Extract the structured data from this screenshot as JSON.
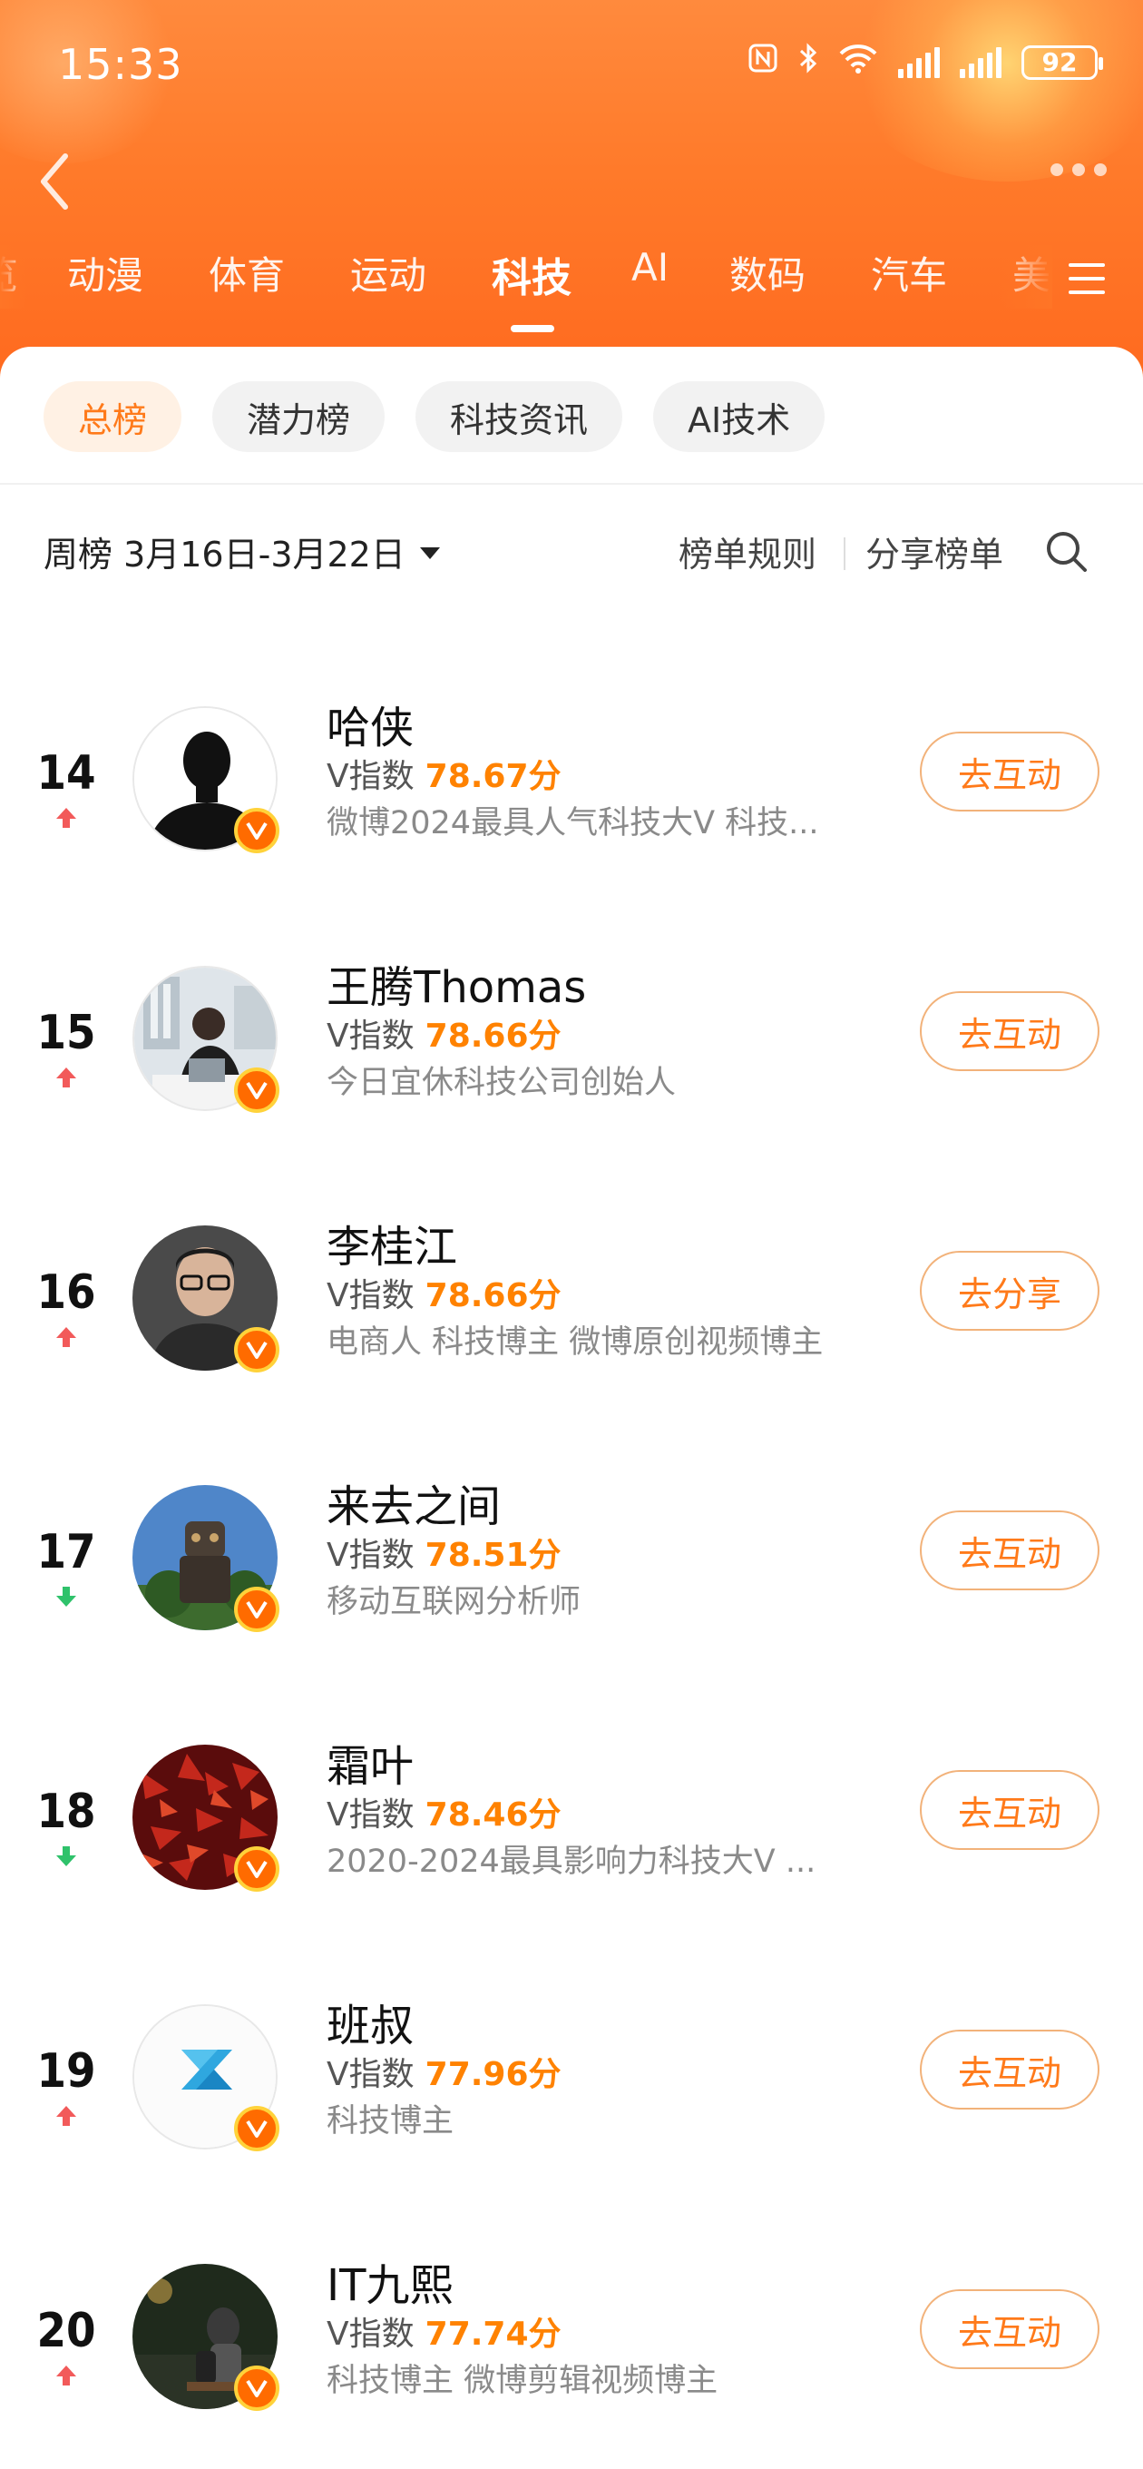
{
  "status_bar": {
    "time": "15:33",
    "battery": "92",
    "icons": [
      "nfc-icon",
      "bluetooth-icon",
      "wifi-icon",
      "signal-icon",
      "signal-icon",
      "battery-icon"
    ]
  },
  "category_tabs": [
    {
      "label": "览",
      "active": false
    },
    {
      "label": "动漫",
      "active": false
    },
    {
      "label": "体育",
      "active": false
    },
    {
      "label": "运动",
      "active": false
    },
    {
      "label": "科技",
      "active": true
    },
    {
      "label": "AI",
      "active": false
    },
    {
      "label": "数码",
      "active": false
    },
    {
      "label": "汽车",
      "active": false
    },
    {
      "label": "美",
      "active": false
    }
  ],
  "sub_tabs": [
    {
      "label": "总榜",
      "active": true
    },
    {
      "label": "潜力榜",
      "active": false
    },
    {
      "label": "科技资讯",
      "active": false
    },
    {
      "label": "AI技术",
      "active": false
    }
  ],
  "filter": {
    "week_label": "周榜 3月16日-3月22日",
    "rules_label": "榜单规则",
    "share_label": "分享榜单"
  },
  "v_index_label": "V指数",
  "rankings": [
    {
      "rank": "14",
      "trend": "up",
      "name": "哈侠",
      "score": "78.67分",
      "desc": "微博2024最具人气科技大V 科技...",
      "action": "去互动",
      "avatar": "silhouette"
    },
    {
      "rank": "15",
      "trend": "up",
      "name": "王腾Thomas",
      "score": "78.66分",
      "desc": "今日宜休科技公司创始人",
      "action": "去互动",
      "avatar": "office"
    },
    {
      "rank": "16",
      "trend": "up",
      "name": "李桂江",
      "score": "78.66分",
      "desc": "电商人 科技博主 微博原创视频博主",
      "action": "去分享",
      "avatar": "portrait"
    },
    {
      "rank": "17",
      "trend": "down",
      "name": "来去之间",
      "score": "78.51分",
      "desc": "移动互联网分析师",
      "action": "去互动",
      "avatar": "robot"
    },
    {
      "rank": "18",
      "trend": "down",
      "name": "霜叶",
      "score": "78.46分",
      "desc": "2020-2024最具影响力科技大V ...",
      "action": "去互动",
      "avatar": "leaves"
    },
    {
      "rank": "19",
      "trend": "up",
      "name": "班叔",
      "score": "77.96分",
      "desc": "科技博主",
      "action": "去互动",
      "avatar": "logo-s"
    },
    {
      "rank": "20",
      "trend": "up",
      "name": "IT九熙",
      "score": "77.74分",
      "desc": "科技博主 微博剪辑视频博主",
      "action": "去互动",
      "avatar": "night"
    }
  ],
  "colors": {
    "header_orange": "#ff7a2a",
    "accent_orange": "#ff8200",
    "trend_up": "#f25a5a",
    "trend_down": "#2fc26b"
  }
}
